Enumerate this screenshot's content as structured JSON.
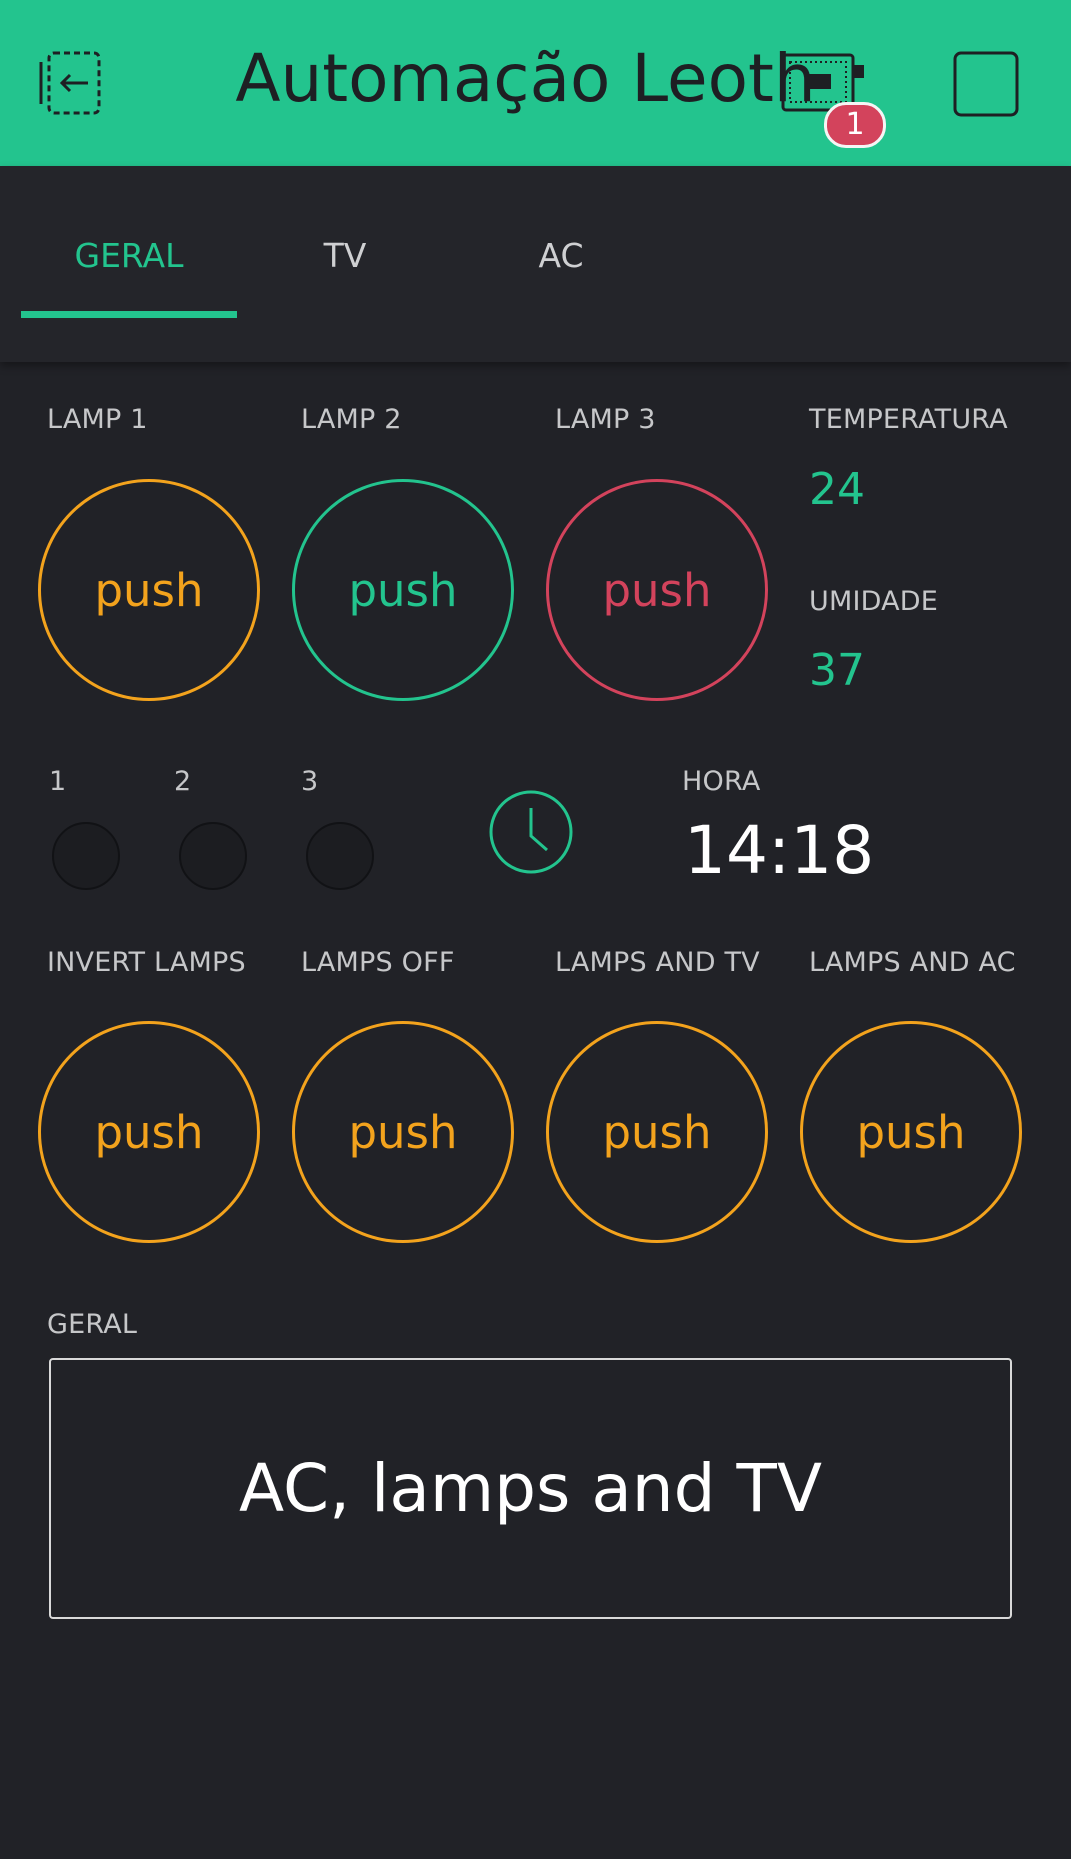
{
  "header": {
    "title": "Automação Leoth",
    "notification_count": "1",
    "bg_color": "#23c48e"
  },
  "tabs": [
    {
      "label": "GERAL",
      "active": true
    },
    {
      "label": "TV",
      "active": false
    },
    {
      "label": "AC",
      "active": false
    }
  ],
  "lamps": [
    {
      "label": "LAMP 1",
      "button": "push",
      "color": "#f3a31d"
    },
    {
      "label": "LAMP 2",
      "button": "push",
      "color": "#23c48e"
    },
    {
      "label": "LAMP 3",
      "button": "push",
      "color": "#d3435c"
    }
  ],
  "sensors": {
    "temperature_label": "TEMPERATURA",
    "temperature_value": "24",
    "humidity_label": "UMIDADE",
    "humidity_value": "37"
  },
  "leds": [
    {
      "label": "1"
    },
    {
      "label": "2"
    },
    {
      "label": "3"
    }
  ],
  "clock": {
    "icon": "clock-icon",
    "label": "HORA",
    "time": "14:18"
  },
  "scenes": [
    {
      "label": "INVERT LAMPS",
      "button": "push"
    },
    {
      "label": "LAMPS OFF",
      "button": "push"
    },
    {
      "label": "LAMPS AND TV",
      "button": "push"
    },
    {
      "label": "LAMPS AND AC",
      "button": "push"
    }
  ],
  "display": {
    "label": "GERAL",
    "value": "AC, lamps and TV"
  }
}
